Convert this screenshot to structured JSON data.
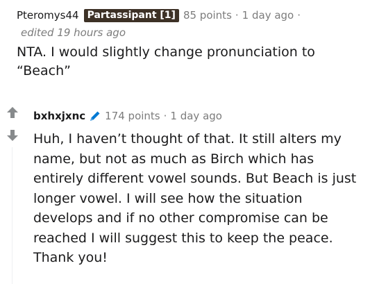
{
  "parent_comment": {
    "username": "Pteromys44",
    "flair": "Partassipant [1]",
    "points": "85 points",
    "separator": "·",
    "time": "1 day ago",
    "trailing_separator": "·",
    "edited": "edited 19 hours ago",
    "body": "NTA. I would slightly change pronunciation to “Beach”"
  },
  "reply_comment": {
    "username": "bxhxjxnc",
    "badge_icon": "pencil-icon",
    "points": "174 points",
    "separator": "·",
    "time": "1 day ago",
    "body": "Huh, I haven’t thought of that. It still alters my name, but not as much as Birch which has entirely different vowel sounds. But Beach is just longer vowel. I will see how the situation develops and if no other compromise can be reached I will suggest this to keep the peace. Thank you!"
  },
  "colors": {
    "text": "#1a1a1b",
    "muted": "#7c7c7c",
    "flair_background": "#3d3126",
    "pencil_blue": "#0079d3",
    "thread_line": "#edeff1"
  }
}
